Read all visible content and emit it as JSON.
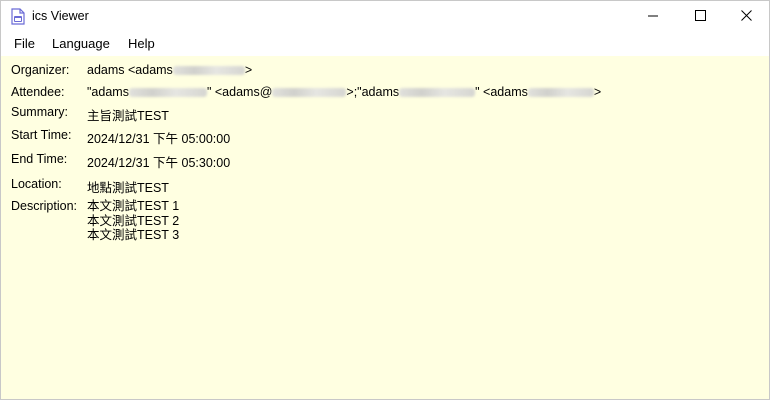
{
  "window": {
    "title": "ics Viewer",
    "icon": "calendar-file-icon"
  },
  "window_controls": {
    "minimize": "minimize-icon",
    "maximize": "maximize-icon",
    "close": "close-icon"
  },
  "menu": {
    "items": [
      {
        "label": "File"
      },
      {
        "label": "Language"
      },
      {
        "label": "Help"
      }
    ]
  },
  "colors": {
    "content_background": "#ffffe1"
  },
  "event": {
    "organizer": {
      "label": "Organizer:",
      "value_prefix": "adams <adams",
      "value_suffix": ">"
    },
    "attendee": {
      "label": "Attendee:",
      "part1": "\"adams",
      "part2": "\" <adams@",
      "part3": ">;\"adams",
      "part4": "\" <adams",
      "part5": ">"
    },
    "summary": {
      "label": "Summary:",
      "value": "主旨測試TEST"
    },
    "start_time": {
      "label": "Start Time:",
      "value": "2024/12/31 下午 05:00:00"
    },
    "end_time": {
      "label": "End Time:",
      "value": "2024/12/31 下午 05:30:00"
    },
    "location": {
      "label": "Location:",
      "value": "地點測試TEST"
    },
    "description": {
      "label": "Description:",
      "lines": [
        "本文測試TEST 1",
        "本文測試TEST 2",
        "本文測試TEST 3"
      ]
    }
  }
}
